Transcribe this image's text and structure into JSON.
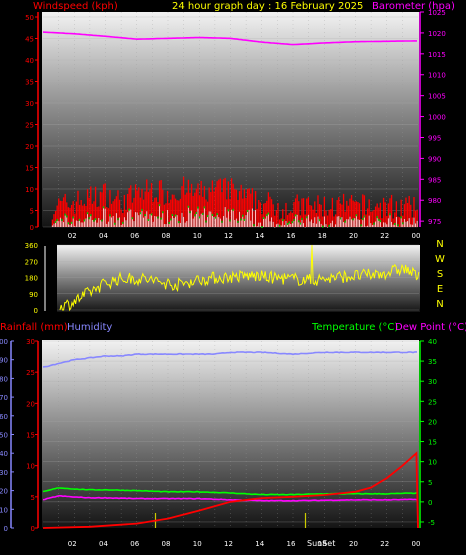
{
  "header": {
    "left": "Windspeed (kph)",
    "center": "24 hour graph day : 16 February 2025",
    "right": "Barometer (hpa)"
  },
  "colors": {
    "bg": "#000000",
    "wind": "#ff0000",
    "gust_highlight": "#00cc00",
    "calm_bars": "#ffffff",
    "barometer": "#ff00ff",
    "direction": "#ffff00",
    "rain": "#ff0000",
    "humidity": "#8888ff",
    "temperature": "#00ff00",
    "dewpoint": "#ff00ff",
    "sun_markers": "#cccc00"
  },
  "time_ticks": [
    "02",
    "04",
    "06",
    "08",
    "10",
    "12",
    "14",
    "16",
    "18",
    "20",
    "22",
    "00"
  ],
  "chart_data": [
    {
      "type": "line",
      "name": "wind-barometer",
      "left_axis": {
        "label": "Windspeed (kph)",
        "ticks": [
          0,
          5,
          10,
          15,
          20,
          25,
          30,
          35,
          40,
          45,
          50
        ],
        "range": [
          0,
          50
        ]
      },
      "right_axis": {
        "label": "Barometer (hpa)",
        "ticks": [
          975,
          980,
          985,
          990,
          995,
          1000,
          1005,
          1010,
          1015,
          1020,
          1025
        ],
        "range": [
          973.6,
          1025
        ]
      },
      "series": [
        {
          "name": "Windspeed (kph)",
          "hours": [
            1,
            2,
            3,
            4,
            5,
            6,
            7,
            8,
            9,
            10,
            11,
            12,
            13,
            14,
            15,
            16,
            17,
            18,
            19,
            20,
            21,
            22,
            23,
            24
          ],
          "values": [
            5,
            6,
            7,
            8,
            6,
            8,
            9,
            8,
            9,
            8,
            9,
            9,
            7,
            6,
            5,
            5,
            5,
            5,
            5,
            5,
            5,
            5,
            5,
            4
          ]
        },
        {
          "name": "Barometer (hpa)",
          "hours": [
            0,
            2,
            4,
            6,
            8,
            10,
            12,
            14,
            16,
            18,
            20,
            22,
            24
          ],
          "values": [
            1020.2,
            1019.8,
            1019.2,
            1018.5,
            1018.7,
            1018.9,
            1018.7,
            1017.8,
            1017.2,
            1017.6,
            1017.9,
            1018.0,
            1018.1
          ]
        }
      ]
    },
    {
      "type": "line",
      "name": "wind-direction",
      "left_axis": {
        "ticks": [
          0,
          90,
          180,
          270,
          360
        ],
        "range": [
          0,
          360
        ]
      },
      "right_axis": {
        "ticks": [
          "N",
          "W",
          "S",
          "E",
          "N"
        ]
      },
      "series": [
        {
          "name": "Direction",
          "hours": [
            0,
            1,
            2,
            3,
            4,
            5,
            6,
            7,
            8,
            9,
            10,
            11,
            12,
            13,
            14,
            15,
            16,
            17,
            18,
            19,
            20,
            21,
            22,
            23,
            24
          ],
          "values": [
            10,
            40,
            90,
            140,
            170,
            175,
            170,
            150,
            140,
            160,
            175,
            180,
            185,
            190,
            180,
            175,
            170,
            165,
            175,
            185,
            190,
            195,
            210,
            230,
            180
          ]
        }
      ]
    },
    {
      "type": "line",
      "name": "rain-humidity-temperature",
      "header_left": [
        "Rainfall (mm)",
        "Humidity"
      ],
      "header_right": [
        "Temperature (°C)",
        "Dew Point (°C)"
      ],
      "left_axis_humidity": {
        "ticks": [
          0,
          10,
          20,
          30,
          40,
          50,
          60,
          70,
          80,
          90,
          100
        ],
        "range": [
          0,
          100
        ]
      },
      "left_axis_rain": {
        "ticks": [
          0,
          5,
          10,
          15,
          20,
          25,
          30
        ],
        "range": [
          0,
          30
        ]
      },
      "right_axis": {
        "label": "Temperature (°C)",
        "ticks": [
          -5,
          0,
          5,
          10,
          15,
          20,
          25,
          30,
          35,
          40
        ],
        "range": [
          -6.5,
          40
        ]
      },
      "sun_label": "SunSet",
      "series": [
        {
          "name": "Humidity",
          "hours": [
            0,
            1,
            2,
            3,
            4,
            5,
            6,
            7,
            8,
            9,
            10,
            11,
            12,
            14,
            16,
            18,
            20,
            22,
            24
          ],
          "values": [
            86,
            88,
            90,
            91,
            92,
            92,
            93,
            93,
            93,
            93,
            93,
            93,
            94,
            94,
            93,
            94,
            94,
            94,
            94
          ]
        },
        {
          "name": "Temperature (°C)",
          "hours": [
            0,
            1,
            2,
            3,
            4,
            6,
            8,
            10,
            12,
            14,
            16,
            18,
            20,
            22,
            24
          ],
          "values": [
            2.5,
            3.5,
            3.2,
            3.0,
            3.0,
            2.8,
            2.5,
            2.5,
            2.2,
            1.8,
            1.8,
            2.0,
            2.0,
            2.0,
            2.2
          ]
        },
        {
          "name": "Dew Point (°C)",
          "hours": [
            0,
            1,
            2,
            3,
            4,
            6,
            8,
            10,
            12,
            14,
            16,
            18,
            20,
            22,
            24
          ],
          "values": [
            0.5,
            1.5,
            1.2,
            1.0,
            1.0,
            0.8,
            0.8,
            0.8,
            0.5,
            0.3,
            0.3,
            0.4,
            0.5,
            0.5,
            0.6
          ]
        },
        {
          "name": "Rainfall (mm)",
          "hours": [
            0,
            3,
            6,
            8,
            10,
            12,
            14,
            16,
            18,
            20,
            21,
            22,
            23,
            23.9,
            24
          ],
          "values": [
            0,
            0.2,
            0.7,
            1.5,
            2.8,
            4.2,
            4.8,
            5.0,
            5.3,
            5.8,
            6.5,
            8.0,
            10.0,
            12.0,
            0
          ]
        }
      ]
    }
  ]
}
